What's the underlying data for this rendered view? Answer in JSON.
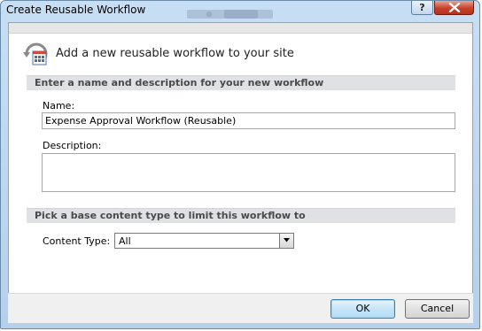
{
  "window": {
    "title": "Create Reusable Workflow",
    "help_label": "?"
  },
  "dialog": {
    "heading": "Add a new reusable workflow to your site"
  },
  "section_name": {
    "title": "Enter a name and description for your new workflow",
    "name_label": "Name:",
    "name_value": "Expense Approval Workflow (Reusable)",
    "description_label": "Description:",
    "description_value": ""
  },
  "section_content_type": {
    "title": "Pick a base content type to limit this workflow to",
    "content_type_label": "Content Type:",
    "content_type_value": "All"
  },
  "buttons": {
    "ok_label": "OK",
    "cancel_label": "Cancel"
  },
  "icons": {
    "workflow": "workflow-icon",
    "close": "close-icon",
    "dropdown": "chevron-down-icon"
  },
  "colors": {
    "close_button": "#c7402b",
    "ok_button_border": "#3c7fb1",
    "section_bar": "#dfe1e4"
  }
}
